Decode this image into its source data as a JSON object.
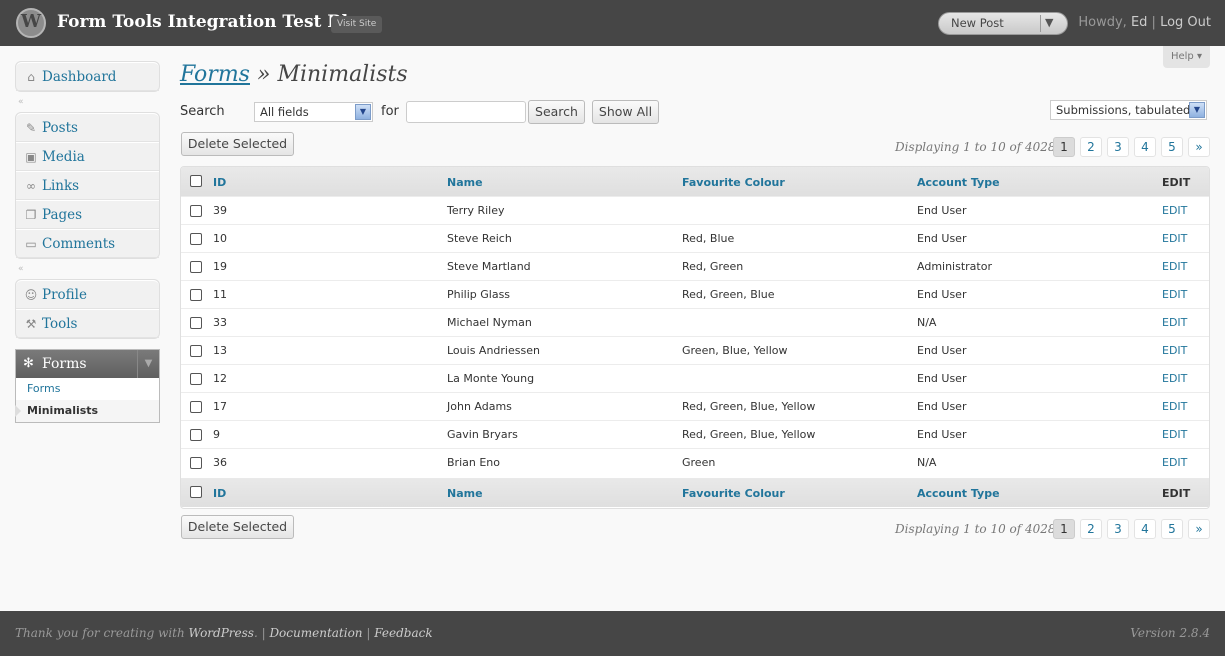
{
  "header": {
    "site_title": "Form Tools Integration Test Blog",
    "visit_site": "Visit Site",
    "new_post": "New Post",
    "howdy_prefix": "Howdy, ",
    "user_name": "Ed",
    "separator": " | ",
    "logout": "Log Out"
  },
  "sidebar": {
    "group1": [
      {
        "label": "Dashboard",
        "icon": "dashboard-icon"
      }
    ],
    "group2": [
      {
        "label": "Posts",
        "icon": "pin-icon"
      },
      {
        "label": "Media",
        "icon": "media-icon"
      },
      {
        "label": "Links",
        "icon": "links-icon"
      },
      {
        "label": "Pages",
        "icon": "pages-icon"
      },
      {
        "label": "Comments",
        "icon": "comments-icon"
      }
    ],
    "group3": [
      {
        "label": "Profile",
        "icon": "profile-icon"
      },
      {
        "label": "Tools",
        "icon": "tools-icon"
      }
    ],
    "forms": {
      "label": "Forms",
      "icon": "gear-icon",
      "sub": [
        "Forms",
        "Minimalists"
      ]
    }
  },
  "help": "Help",
  "page": {
    "breadcrumb_link": "Forms",
    "breadcrumb_sep": " » ",
    "breadcrumb_current": "Minimalists"
  },
  "search": {
    "label": "Search",
    "field_select": "All fields",
    "for_label": "for",
    "input_value": "",
    "search_button": "Search",
    "show_all_button": "Show All",
    "view_select": "Submissions, tabulated"
  },
  "actions": {
    "delete_selected": "Delete Selected"
  },
  "pagination": {
    "displaying": "Displaying 1 to 10 of 4028",
    "pages": [
      "1",
      "2",
      "3",
      "4",
      "5",
      "»"
    ],
    "current": "1"
  },
  "table": {
    "columns": [
      "ID",
      "Name",
      "Favourite Colour",
      "Account Type",
      "EDIT"
    ],
    "rows": [
      {
        "id": "39",
        "name": "Terry Riley",
        "colour": "",
        "account": "End User",
        "edit": "EDIT"
      },
      {
        "id": "10",
        "name": "Steve Reich",
        "colour": "Red, Blue",
        "account": "End User",
        "edit": "EDIT"
      },
      {
        "id": "19",
        "name": "Steve Martland",
        "colour": "Red, Green",
        "account": "Administrator",
        "edit": "EDIT"
      },
      {
        "id": "11",
        "name": "Philip Glass",
        "colour": "Red, Green, Blue",
        "account": "End User",
        "edit": "EDIT"
      },
      {
        "id": "33",
        "name": "Michael Nyman",
        "colour": "",
        "account": "N/A",
        "edit": "EDIT"
      },
      {
        "id": "13",
        "name": "Louis Andriessen",
        "colour": "Green, Blue, Yellow",
        "account": "End User",
        "edit": "EDIT"
      },
      {
        "id": "12",
        "name": "La Monte Young",
        "colour": "",
        "account": "End User",
        "edit": "EDIT"
      },
      {
        "id": "17",
        "name": "John Adams",
        "colour": "Red, Green, Blue, Yellow",
        "account": "End User",
        "edit": "EDIT"
      },
      {
        "id": "9",
        "name": "Gavin Bryars",
        "colour": "Red, Green, Blue, Yellow",
        "account": "End User",
        "edit": "EDIT"
      },
      {
        "id": "36",
        "name": "Brian Eno",
        "colour": "Green",
        "account": "N/A",
        "edit": "EDIT"
      }
    ]
  },
  "footer": {
    "thanks": "Thank you for creating with ",
    "wordpress": "WordPress",
    "dot": ". | ",
    "documentation": "Documentation",
    "sep": " | ",
    "feedback": "Feedback",
    "version": "Version 2.8.4"
  },
  "colors": {
    "link": "#21759b",
    "header_bg": "#464646",
    "page_bg": "#f9f9f9"
  }
}
